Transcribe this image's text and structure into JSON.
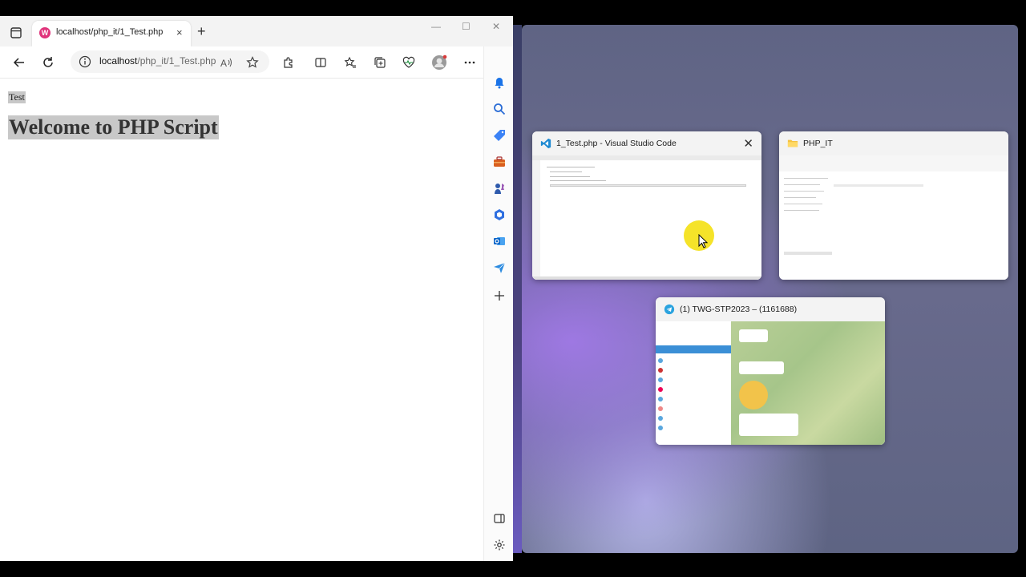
{
  "browser": {
    "tab": {
      "title": "localhost/php_it/1_Test.php",
      "favicon": "W"
    },
    "new_tab_symbol": "+",
    "close_symbol": "×",
    "window_controls": {
      "minimize": "—",
      "maximize": "☐",
      "close": "✕"
    },
    "address": {
      "host": "localhost",
      "path": "/php_it/1_Test.php"
    }
  },
  "page": {
    "small_text": "Test",
    "heading": "Welcome to PHP Script"
  },
  "task_switcher": {
    "cards": [
      {
        "title": "1_Test.php - Visual Studio Code",
        "icon": "vscode-icon",
        "close": "✕"
      },
      {
        "title": "PHP_IT",
        "icon": "folder-icon"
      },
      {
        "title": "(1) TWG-STP2023 – (1161688)",
        "icon": "telegram-icon"
      }
    ]
  },
  "colors": {
    "accent": "#0078d4",
    "selection": "#c8c8c8",
    "highlight_cursor": "#f4e21e"
  }
}
